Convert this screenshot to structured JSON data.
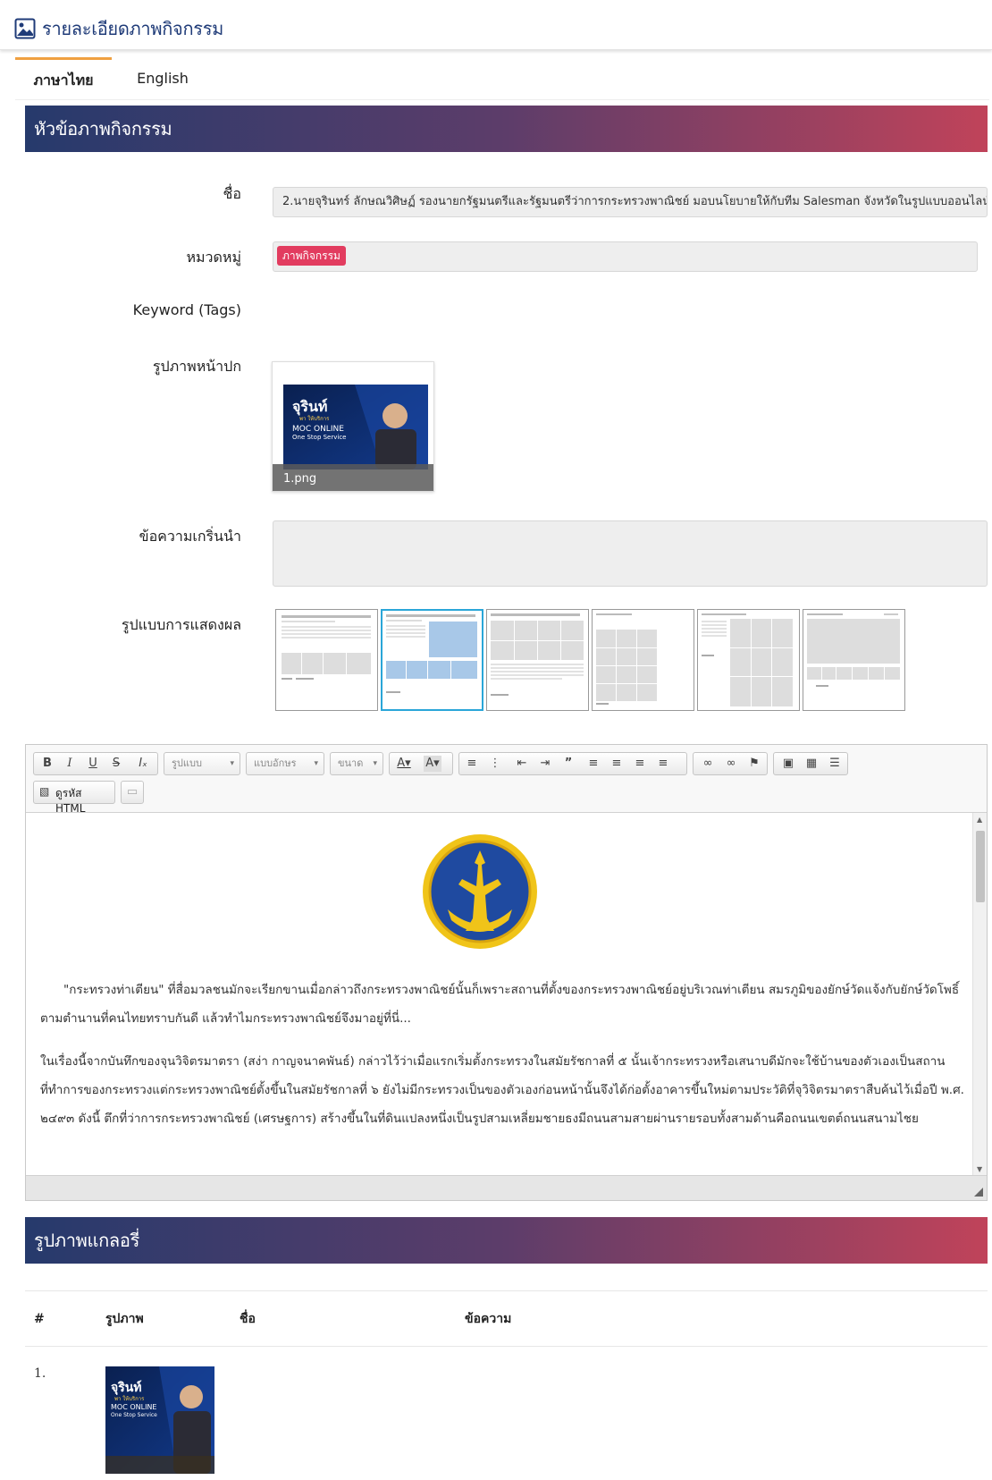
{
  "header": {
    "title": "รายละเอียดภาพกิจกรรม",
    "icon": "image-icon"
  },
  "tabs": [
    {
      "label": "ภาษาไทย"
    },
    {
      "label": "English"
    }
  ],
  "section1": {
    "title": "หัวข้อภาพกิจกรรม"
  },
  "form": {
    "name_label": "ชื่อ",
    "name_value": "2.นายจุรินทร์ ลักษณวิศิษฏ์ รองนายกรัฐมนตรีและรัฐมนตรีว่าการกระทรวงพาณิชย์ มอบนโยบายให้กับทีม Salesman จังหวัดในรูปแบบออนไลน์",
    "category_label": "หมวดหมู่",
    "category_badge": "ภาพกิจกรรม",
    "keyword_label": "Keyword (Tags)",
    "cover_label": "รูปภาพหน้าปก",
    "cover_filename": "1.png",
    "intro_label": "ข้อความเกริ่นนำ",
    "intro_value": "",
    "layout_label": "รูปแบบการแสดงผล",
    "layout_selected_index": 1,
    "layout_count": 6
  },
  "editor": {
    "format_placeholder": "รูปแบบ",
    "font_placeholder": "แบบอักษร",
    "size_placeholder": "ขนาด",
    "source_label": "ดูรหัส HTML",
    "paragraph1": "\"กระทรวงท่าเตียน\" ที่สื่อมวลชนมักจะเรียกขานเมื่อกล่าวถึงกระทรวงพาณิชย์นั้นก็เพราะสถานที่ตั้งของกระทรวงพาณิชย์อยู่บริเวณท่าเตียน สมรภูมิของยักษ์วัดแจ้งกับยักษ์วัดโพธิ์ตามตำนานที่คนไทยทราบกันดี แล้วทำไมกระทรวงพาณิชย์จึงมาอยู่ที่นี่...",
    "paragraph2": "ในเรื่องนี้จากบันทึกของจุนวิจิตรมาตรา (สง่า กาญจนาคพันธ์) กล่าวไว้ว่าเมื่อแรกเริ่มตั้งกระทรวงในสมัยรัชกาลที่ ๕ นั้นเจ้ากระทรวงหรือเสนาบดีมักจะใช้บ้านของตัวเองเป็นสถานที่ทำการของกระทรวงแต่กระทรวงพาณิชย์ตั้งขึ้นในสมัยรัชกาลที่ ๖ ยังไม่มีกระทรวงเป็นของตัวเองก่อนหน้านั้นจึงได้ก่อตั้งอาคารขึ้นใหม่ตามประวัติที่จุวิจิตรมาตราสืบค้นไว้เมื่อปี พ.ศ. ๒๔๙๓ ดังนี้ ตึกที่ว่าการกระทรวงพาณิชย์ (เศรษฐการ) สร้างขึ้นในที่ดินแปลงหนึ่งเป็นรูปสามเหลี่ยมชายธงมีถนนสามสายผ่านรายรอบทั้งสามด้านคือถนนเขตต์ถนนสนามไชย"
  },
  "section2": {
    "title": "รูปภาพแกลอรี่"
  },
  "gallery": {
    "headers": [
      "#",
      "รูปภาพ",
      "ชื่อ",
      "ข้อความ"
    ],
    "rows": [
      {
        "index": "1.",
        "name": "",
        "text": ""
      }
    ]
  },
  "thumb_texts": {
    "name": "จุรินท์",
    "line1": "พา ให้บริการ",
    "line2": "MOC ONLINE",
    "line3": "One Stop Service"
  },
  "colors": {
    "accent": "#1f3b78",
    "band_start": "#263a6c",
    "band_end": "#c0435a",
    "badge": "#e23c5f",
    "tab_active": "#f0a040",
    "layout_selected": "#2aa6d8"
  }
}
